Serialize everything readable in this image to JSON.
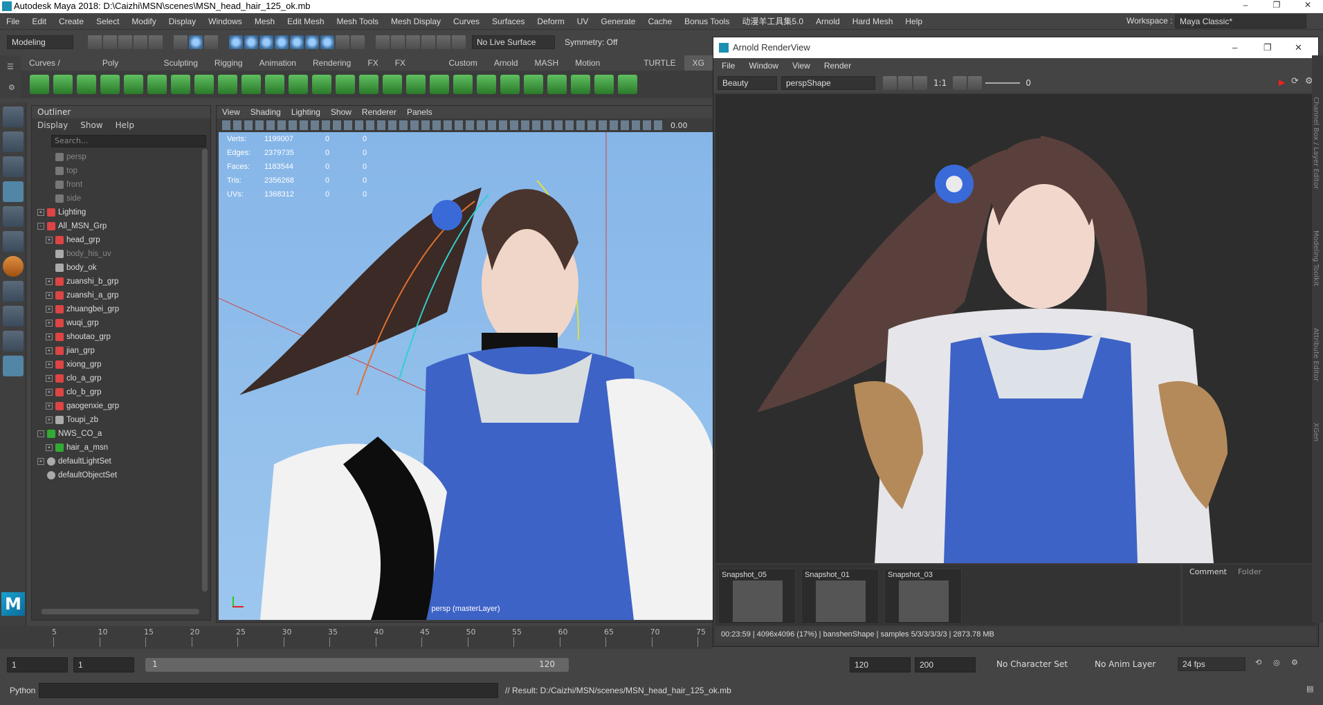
{
  "window": {
    "title": "Autodesk Maya 2018: D:\\Caizhi\\MSN\\scenes\\MSN_head_hair_125_ok.mb",
    "min": "–",
    "max": "❐",
    "close": "✕"
  },
  "menubar": {
    "items": [
      "File",
      "Edit",
      "Create",
      "Select",
      "Modify",
      "Display",
      "Windows",
      "Mesh",
      "Edit Mesh",
      "Mesh Tools",
      "Mesh Display",
      "Curves",
      "Surfaces",
      "Deform",
      "UV",
      "Generate",
      "Cache",
      "Bonus Tools",
      "动漫羊工具集5.0",
      "Arnold",
      "Hard Mesh",
      "Help"
    ],
    "workspace_label": "Workspace :",
    "workspace_value": "Maya Classic*"
  },
  "statusline": {
    "mode": "Modeling",
    "live_surface": "No Live Surface",
    "symmetry": "Symmetry: Off"
  },
  "shelf": {
    "tabs": [
      "Curves / Surfaces",
      "Poly Modeling",
      "Sculpting",
      "Rigging",
      "Animation",
      "Rendering",
      "FX",
      "FX Caching",
      "Custom",
      "Arnold",
      "MASH",
      "Motion Graphics",
      "TURTLE",
      "XG"
    ]
  },
  "outliner": {
    "title": "Outliner",
    "menu": [
      "Display",
      "Show",
      "Help"
    ],
    "search_placeholder": "Search...",
    "items": [
      {
        "label": "persp",
        "level": 1,
        "dim": true,
        "expander": false,
        "icon": "camera-icon"
      },
      {
        "label": "top",
        "level": 1,
        "dim": true,
        "expander": false,
        "icon": "camera-icon"
      },
      {
        "label": "front",
        "level": 1,
        "dim": true,
        "expander": false,
        "icon": "camera-icon"
      },
      {
        "label": "side",
        "level": 1,
        "dim": true,
        "expander": false,
        "icon": "camera-icon"
      },
      {
        "label": "Lighting",
        "level": 0,
        "dim": false,
        "expander": "+",
        "icon": "group-icon"
      },
      {
        "label": "All_MSN_Grp",
        "level": 0,
        "dim": false,
        "expander": "-",
        "icon": "group-icon"
      },
      {
        "label": "head_grp",
        "level": 1,
        "dim": false,
        "expander": "+",
        "icon": "group-icon"
      },
      {
        "label": "body_his_uv",
        "level": 1,
        "dim": true,
        "expander": false,
        "icon": "mesh-icon"
      },
      {
        "label": "body_ok",
        "level": 1,
        "dim": false,
        "expander": false,
        "icon": "mesh-icon"
      },
      {
        "label": "zuanshi_b_grp",
        "level": 1,
        "dim": false,
        "expander": "+",
        "icon": "group-icon"
      },
      {
        "label": "zuanshi_a_grp",
        "level": 1,
        "dim": false,
        "expander": "+",
        "icon": "group-icon"
      },
      {
        "label": "zhuangbei_grp",
        "level": 1,
        "dim": false,
        "expander": "+",
        "icon": "group-icon"
      },
      {
        "label": "wuqi_grp",
        "level": 1,
        "dim": false,
        "expander": "+",
        "icon": "group-icon"
      },
      {
        "label": "shoutao_grp",
        "level": 1,
        "dim": false,
        "expander": "+",
        "icon": "group-icon"
      },
      {
        "label": "jian_grp",
        "level": 1,
        "dim": false,
        "expander": "+",
        "icon": "group-icon"
      },
      {
        "label": "xiong_grp",
        "level": 1,
        "dim": false,
        "expander": "+",
        "icon": "group-icon"
      },
      {
        "label": "clo_a_grp",
        "level": 1,
        "dim": false,
        "expander": "+",
        "icon": "group-icon"
      },
      {
        "label": "clo_b_grp",
        "level": 1,
        "dim": false,
        "expander": "+",
        "icon": "group-icon"
      },
      {
        "label": "gaogenxie_grp",
        "level": 1,
        "dim": false,
        "expander": "+",
        "icon": "group-icon"
      },
      {
        "label": "Toupi_zb",
        "level": 1,
        "dim": false,
        "expander": "+",
        "icon": "mesh-icon"
      },
      {
        "label": "NWS_CO_a",
        "level": 0,
        "dim": false,
        "expander": "-",
        "icon": "xgen-icon"
      },
      {
        "label": "hair_a_msn",
        "level": 1,
        "dim": false,
        "expander": "+",
        "icon": "xgen-icon"
      },
      {
        "label": "defaultLightSet",
        "level": 0,
        "dim": false,
        "expander": "+",
        "icon": "set-icon"
      },
      {
        "label": "defaultObjectSet",
        "level": 0,
        "dim": false,
        "expander": false,
        "icon": "set-icon"
      }
    ]
  },
  "viewport": {
    "menu": [
      "View",
      "Shading",
      "Lighting",
      "Show",
      "Renderer",
      "Panels"
    ],
    "exposure": "0.00",
    "hud": [
      {
        "label": "Verts:",
        "v1": "1199007",
        "v2": "0",
        "v3": "0"
      },
      {
        "label": "Edges:",
        "v1": "2379735",
        "v2": "0",
        "v3": "0"
      },
      {
        "label": "Faces:",
        "v1": "1183544",
        "v2": "0",
        "v3": "0"
      },
      {
        "label": "Tris:",
        "v1": "2356268",
        "v2": "0",
        "v3": "0"
      },
      {
        "label": "UVs:",
        "v1": "1368312",
        "v2": "0",
        "v3": "0"
      }
    ],
    "camera_label": "persp (masterLayer)"
  },
  "renderview": {
    "title": "Arnold RenderView",
    "menu": [
      "File",
      "Window",
      "View",
      "Render"
    ],
    "aov": "Beauty",
    "camera": "perspShape",
    "ratio": "1:1",
    "exposure": "0",
    "snapshots": [
      "Snapshot_05",
      "Snapshot_01",
      "Snapshot_03"
    ],
    "comment_tabs": [
      "Comment",
      "Folder"
    ],
    "status": "00:23:59 | 4096x4096 (17%) | banshenShape  | samples 5/3/3/3/3/3 | 2873.78 MB"
  },
  "timeline": {
    "ticks": [
      "5",
      "10",
      "15",
      "20",
      "25",
      "30",
      "35",
      "40",
      "45",
      "50",
      "55",
      "60",
      "65",
      "70",
      "75"
    ]
  },
  "range": {
    "start": "1",
    "anim_start": "1",
    "slider_start": "1",
    "slider_end": "120",
    "end": "120",
    "anim_end": "200",
    "character_set": "No Character Set",
    "anim_layer": "No Anim Layer",
    "fps": "24 fps"
  },
  "cmdline": {
    "lang": "Python",
    "result": "// Result: D:/Caizhi/MSN/scenes/MSN_head_hair_125_ok.mb"
  },
  "rightstrip": {
    "labels": [
      "Channel Box / Layer Editor",
      "Modeling Toolkit",
      "Attribute Editor",
      "XGen"
    ]
  },
  "colors": {
    "accent": "#5285a6",
    "viewport_bg": "#8bb9e8"
  }
}
